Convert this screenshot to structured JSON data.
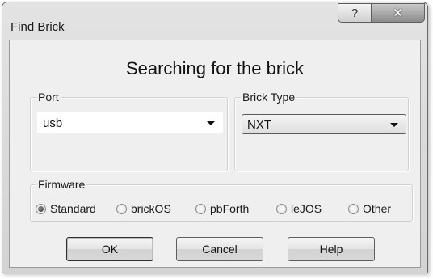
{
  "window": {
    "title": "Find Brick",
    "help_glyph": "?",
    "close_glyph": "✕"
  },
  "main": {
    "heading": "Searching for the brick"
  },
  "port": {
    "label": "Port",
    "value": "usb"
  },
  "brick_type": {
    "label": "Brick Type",
    "value": "NXT"
  },
  "firmware": {
    "label": "Firmware",
    "options": [
      {
        "label": "Standard",
        "checked": true
      },
      {
        "label": "brickOS",
        "checked": false
      },
      {
        "label": "pbForth",
        "checked": false
      },
      {
        "label": "leJOS",
        "checked": false
      },
      {
        "label": "Other",
        "checked": false
      }
    ]
  },
  "buttons": {
    "ok": "OK",
    "cancel": "Cancel",
    "help": "Help"
  }
}
